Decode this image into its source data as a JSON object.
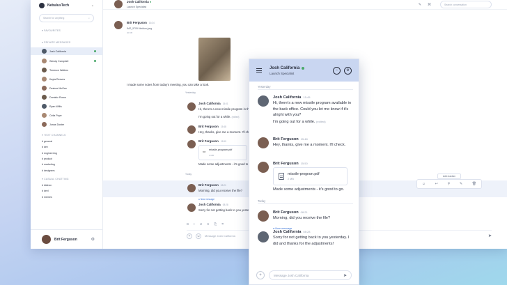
{
  "workspace": {
    "name": "NebulusTech"
  },
  "sidebar": {
    "search_placeholder": "Search for anything",
    "favourites_title": "FAVOURITES",
    "private_title": "PRIVATE MESSAGES",
    "users": [
      "Josh California",
      "Wendy Campbell",
      "Terrence Walters",
      "Kayla Reeves",
      "Desiree McGee",
      "Dominic Rocco",
      "Ryan Willis",
      "Celia Pope",
      "Jonas Doster"
    ],
    "text_channels_title": "TEXT CHANNELS",
    "channels": [
      "# general",
      "# dev",
      "# engineering",
      "# product",
      "# marketing",
      "# designers"
    ],
    "casual_title": "CASUAL CHATTING",
    "casual_channels": [
      "# kitchen",
      "# devl",
      "# memes"
    ],
    "me": "Brit Ferguson"
  },
  "header": {
    "search_placeholder": "Search conversation"
  },
  "main": {
    "top_name": "Josh California",
    "top_role": "Launch Specialist",
    "m1_name": "Brit Ferguson",
    "m1_time": "16:34",
    "m1_file": "IMG_9705 Medium.jpeg",
    "m1_size": "40 KB",
    "m1_text": "I made some notes from today's meeting, you can take a look.",
    "day_yesterday": "Yesterday",
    "m2_name": "Josh California",
    "m2_time": "15:01",
    "m2_text": "Hi, there's a new missile program in the back office. Could you let",
    "m2_text2": "I'm going out for a while.",
    "m2_edited": "(edited)",
    "m3_name": "Brit Ferguson",
    "m3_time": "15:48",
    "m3_text": "Hey, thanks, give me a moment. I'll check.",
    "m4_name": "Brit Ferguson",
    "m4_time": "15:50",
    "m4_file": "missile-program.pdf",
    "m4_size": "2 MB",
    "m4_text": "Made some adjustments - it's good to go.",
    "day_today": "Today",
    "m5_name": "Brit Ferguson",
    "m5_time": "08:21",
    "m5_text": "Morning, did you receive the file?",
    "new_message": "New message",
    "m6_name": "Josh California",
    "m6_time": "08:28",
    "m6_text": "Sorry for not getting back to you yesterday. I did and thanks for the adjustm",
    "composer_placeholder": "Message Josh California",
    "add_reaction": "Add reaction"
  },
  "mobile": {
    "name": "Josh California",
    "role": "Launch Specialist",
    "day_yesterday": "Yesterday",
    "day_today": "Today",
    "msgs": [
      {
        "name": "Josh California",
        "time": "15:45",
        "text": "Hi, there's a new missile program available in the back office. Could you let me know if it's alright with you?",
        "text2": "I'm going out for a while.",
        "edited": "(edited)"
      },
      {
        "name": "Brit Ferguson",
        "time": "15:48",
        "text": "Hey, thanks, give me a moment. I'll check."
      },
      {
        "name": "Brit Ferguson",
        "time": "15:50",
        "file": "missile-program.pdf",
        "size": "2 MB",
        "text": "Made some adjustments - it's good to go."
      },
      {
        "name": "Brit Ferguson",
        "time": "08:21",
        "text": "Morning, did you receive the file?"
      },
      {
        "name": "Josh California",
        "time": "08:28",
        "new": "New message",
        "text": "Sorry for not getting back to you yesterday. I did and thanks for the adjustments!"
      }
    ],
    "composer_placeholder": "Message Josh California"
  }
}
